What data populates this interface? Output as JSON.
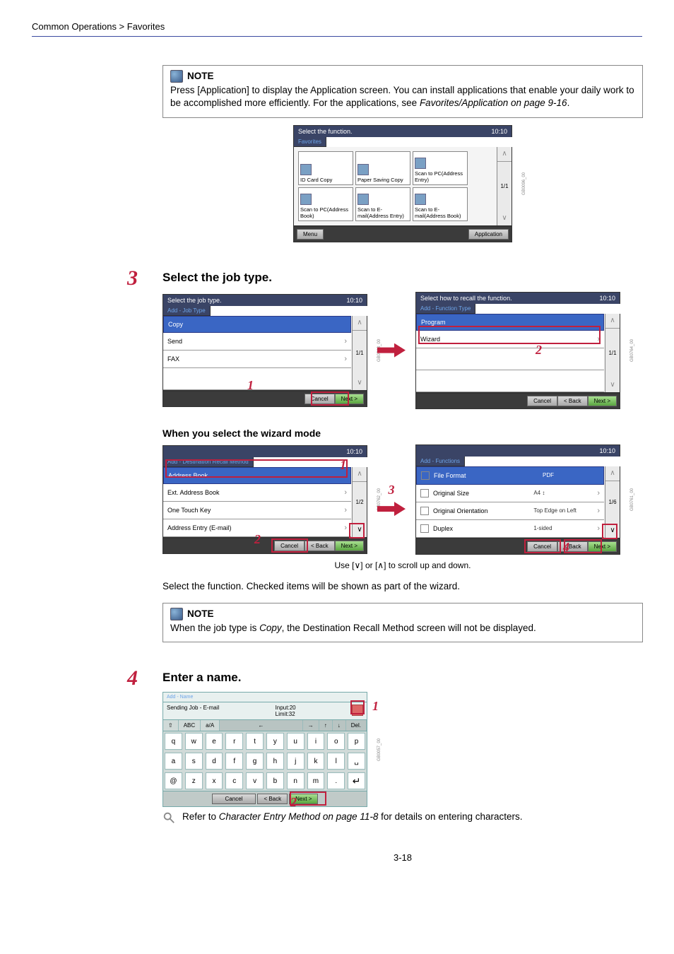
{
  "breadcrumb": "Common Operations > Favorites",
  "note1": {
    "title": "NOTE",
    "body_a": "Press [Application] to display the Application screen. You can install applications that enable your daily work to be accomplished more efficiently. For the applications, see ",
    "body_b": "Favorites/Application on page 9-16",
    "body_c": "."
  },
  "fav_panel": {
    "title": "Select the function.",
    "time": "10:10",
    "tab": "Favorites",
    "items": [
      "ID Card Copy",
      "Paper Saving Copy",
      "Scan to PC(Address Entry)",
      "Scan to PC(Address Book)",
      "Scan to E-mail(Address Entry)",
      "Scan to E-mail(Address Book)"
    ],
    "page": "1/1",
    "menu": "Menu",
    "application": "Application",
    "code": "GB0096_00"
  },
  "step3": {
    "num": "3",
    "heading": "Select the job type.",
    "left": {
      "title": "Select the job type.",
      "time": "10:10",
      "tab": "Add - Job Type",
      "items": [
        "Copy",
        "Send",
        "FAX"
      ],
      "page": "1/1",
      "cancel": "Cancel",
      "next": "Next >",
      "code": "GB0763_00",
      "callout": "1"
    },
    "right": {
      "title": "Select how to recall the function.",
      "time": "10:10",
      "tab": "Add - Function Type",
      "items": [
        "Program",
        "Wizard"
      ],
      "page": "1/1",
      "cancel": "Cancel",
      "back": "< Back",
      "next": "Next >",
      "code": "GB0764_00",
      "callout": "2"
    }
  },
  "wizard": {
    "subheading": "When you select the wizard mode",
    "left": {
      "time": "10:10",
      "tab": "Add - Destination Recall Method",
      "items": [
        "Address Book",
        "Ext. Address Book",
        "One Touch Key",
        "Address Entry (E-mail)"
      ],
      "page": "1/2",
      "cancel": "Cancel",
      "back": "< Back",
      "next": "Next >",
      "code": "GB0762_00",
      "callout_top": "1",
      "callout_left": "2",
      "callout_mid": "3"
    },
    "right": {
      "time": "10:10",
      "tab": "Add - Functions",
      "rows": [
        {
          "name": "File Format",
          "val": "PDF",
          "checked": true
        },
        {
          "name": "Original Size",
          "val": "A4 ↕",
          "checked": false
        },
        {
          "name": "Original Orientation",
          "val": "Top Edge on Left",
          "checked": false
        },
        {
          "name": "Duplex",
          "val": "1-sided",
          "checked": false
        }
      ],
      "page": "1/6",
      "cancel": "Cancel",
      "back": "< Back",
      "next": "Next >",
      "code": "GB0761_00",
      "callout": "4"
    },
    "scroll_note": "Use [∨] or [∧] to scroll up and down.",
    "body_text": "Select the function. Checked items will be shown as part of the wizard."
  },
  "note2": {
    "title": "NOTE",
    "body_a": "When the job type is ",
    "body_b": "Copy",
    "body_c": ", the Destination Recall Method screen will not be displayed."
  },
  "step4": {
    "num": "4",
    "heading": "Enter a name.",
    "kbd": {
      "tab": "Add - Name",
      "job": "Sending Job - E-mail",
      "input": "Input:20",
      "limit": "Limit:32",
      "modes": [
        "⇧",
        "ABC",
        "a/A",
        "←",
        "→",
        "↑",
        "↓",
        "Del."
      ],
      "row1": [
        "q",
        "w",
        "e",
        "r",
        "t",
        "y",
        "u",
        "i",
        "o",
        "p"
      ],
      "row2": [
        "a",
        "s",
        "d",
        "f",
        "g",
        "h",
        "j",
        "k",
        "l",
        "␣"
      ],
      "row3": [
        "@",
        "z",
        "x",
        "c",
        "v",
        "b",
        "n",
        "m",
        ".",
        "↵"
      ],
      "cancel": "Cancel",
      "back": "< Back",
      "next": "Next >",
      "code": "GB0057_00",
      "callout_top": "1",
      "callout_bot": "2"
    },
    "ref_a": "Refer to ",
    "ref_b": "Character Entry Method on page 11-8",
    "ref_c": " for details on entering characters."
  },
  "pagenum": "3-18"
}
